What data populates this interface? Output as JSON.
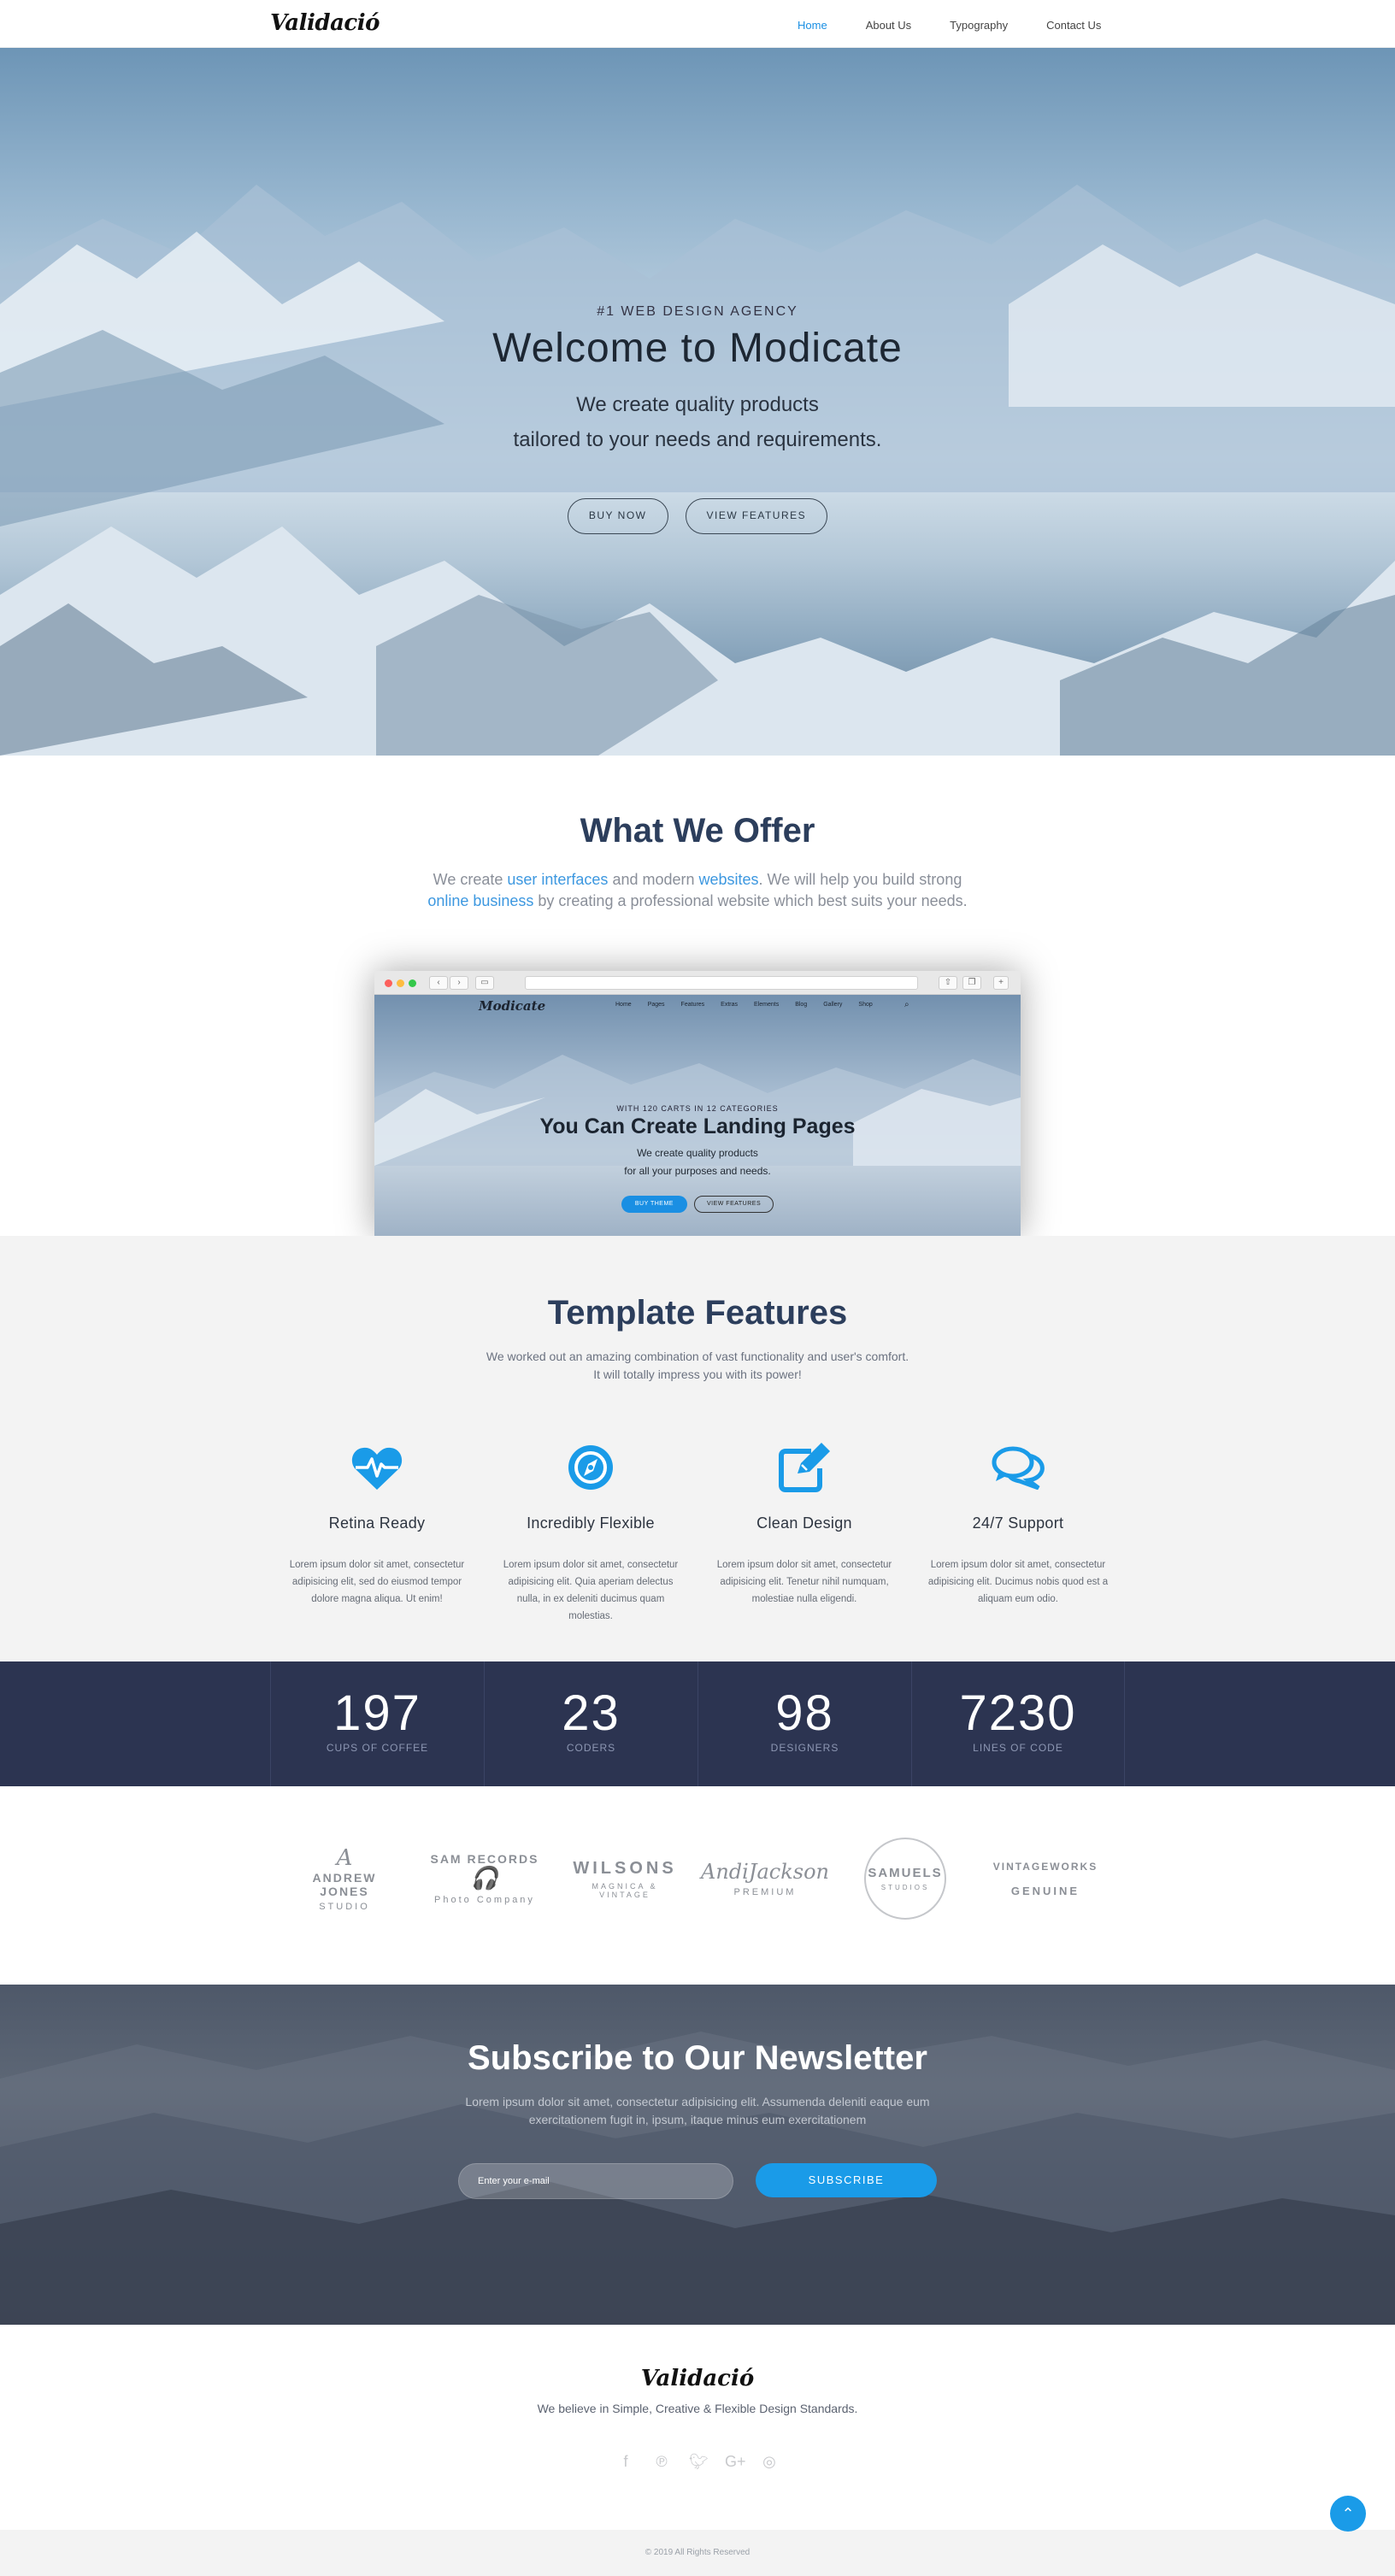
{
  "nav": {
    "logo": "Validació",
    "items": [
      {
        "label": "Home",
        "active": true
      },
      {
        "label": "About Us",
        "active": false
      },
      {
        "label": "Typography",
        "active": false
      },
      {
        "label": "Contact Us",
        "active": false
      }
    ]
  },
  "hero": {
    "kicker": "#1 WEB DESIGN AGENCY",
    "title": "Welcome to Modicate",
    "sub_line1": "We create quality products",
    "sub_line2": "tailored to your needs and requirements.",
    "btn_buy": "BUY NOW",
    "btn_features": "VIEW FEATURES"
  },
  "offer": {
    "title": "What We Offer",
    "lead_1": "We create ",
    "lead_hl1": "user interfaces",
    "lead_2": " and modern ",
    "lead_hl2": "websites",
    "lead_3": ". We will help you build strong ",
    "lead_hl3": "online business",
    "lead_4": " by creating a professional website which best suits your needs.",
    "mock": {
      "logo": "Modicate",
      "menu": [
        "Home",
        "Pages",
        "Features",
        "Extras",
        "Elements",
        "Blog",
        "Gallery",
        "Shop"
      ],
      "kicker": "WITH 120 CARTS IN 12 CATEGORIES",
      "title": "You Can Create Landing Pages",
      "sub1": "We create quality products",
      "sub2": "for all your purposes and needs.",
      "btn1": "BUY THEME",
      "btn2": "VIEW FEATURES"
    }
  },
  "features": {
    "title": "Template Features",
    "lead": "We worked out an amazing combination of vast functionality and user's comfort. It will totally impress you with its power!",
    "items": [
      {
        "icon": "heartbeat-icon",
        "title": "Retina Ready",
        "text": "Lorem ipsum dolor sit amet, consectetur adipisicing elit, sed do eiusmod tempor dolore magna aliqua. Ut enim!"
      },
      {
        "icon": "compass-icon",
        "title": "Incredibly Flexible",
        "text": "Lorem ipsum dolor sit amet, consectetur adipisicing elit. Quia aperiam delectus nulla, in ex deleniti ducimus quam molestias."
      },
      {
        "icon": "edit-icon",
        "title": "Clean Design",
        "text": "Lorem ipsum dolor sit amet, consectetur adipisicing elit. Tenetur nihil numquam, molestiae nulla eligendi."
      },
      {
        "icon": "chat-icon",
        "title": "24/7 Support",
        "text": "Lorem ipsum dolor sit amet, consectetur adipisicing elit. Ducimus nobis quod est a aliquam eum odio."
      }
    ],
    "accent": "#1a9be8"
  },
  "stats": [
    {
      "value": "197",
      "label": "CUPS OF COFFEE"
    },
    {
      "value": "23",
      "label": "CODERS"
    },
    {
      "value": "98",
      "label": "DESIGNERS"
    },
    {
      "value": "7230",
      "label": "LINES OF CODE"
    }
  ],
  "clients": [
    {
      "t1": "ANDREW JONES",
      "t2": "STUDIO"
    },
    {
      "t1": "SAM RECORDS",
      "t2": "Photo Company"
    },
    {
      "t1": "WILSONS",
      "t2": "MAGNICA & VINTAGE"
    },
    {
      "t1": "AndiJackson",
      "t2": "PREMIUM"
    },
    {
      "t1": "SAMUELS",
      "t2": "STUDIOS"
    },
    {
      "t1": "VINTAGEWORKS",
      "t2": "GENUINE"
    }
  ],
  "newsletter": {
    "title": "Subscribe to Our Newsletter",
    "text": "Lorem ipsum dolor sit amet, consectetur adipisicing elit. Assumenda deleniti eaque eum exercitationem fugit in, ipsum, itaque minus eum exercitationem",
    "placeholder": "Enter your e-mail",
    "button": "SUBSCRIBE"
  },
  "footer": {
    "logo": "Validació",
    "tagline": "We believe in Simple, Creative & Flexible Design Standards.",
    "social": [
      "facebook-icon",
      "pinterest-icon",
      "twitter-icon",
      "google-plus-icon",
      "instagram-icon"
    ],
    "copyright": "© 2019 All Rights Reserved"
  },
  "colors": {
    "accent": "#1a9be8",
    "navy": "#2c3451",
    "heading": "#2c3e5c"
  }
}
